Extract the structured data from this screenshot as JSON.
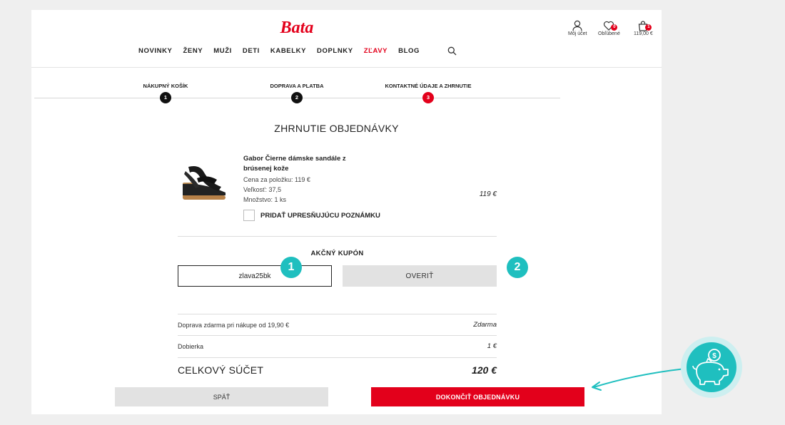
{
  "brand": {
    "logo_text": "Bata"
  },
  "account": {
    "my_account": "Môj účet",
    "favorites": "Obľúbené",
    "favorites_count": "0",
    "cart_total": "119,00 €",
    "cart_count": "1"
  },
  "nav": {
    "items": [
      {
        "label": "NOVINKY"
      },
      {
        "label": "ŽENY"
      },
      {
        "label": "MUŽI"
      },
      {
        "label": "DETI"
      },
      {
        "label": "KABELKY"
      },
      {
        "label": "DOPLNKY"
      },
      {
        "label": "ZĽAVY",
        "highlight": true
      },
      {
        "label": "BLOG"
      }
    ],
    "search_icon": "search-icon"
  },
  "steps": [
    {
      "label": "NÁKUPNÝ KOŠÍK",
      "number": "1"
    },
    {
      "label": "DOPRAVA A PLATBA",
      "number": "2"
    },
    {
      "label": "KONTAKTNÉ ÚDAJE A ZHRNUTIE",
      "number": "3",
      "active": true
    }
  ],
  "summary": {
    "title": "ZHRNUTIE OBJEDNÁVKY"
  },
  "product": {
    "name_line1": "Gabor Čierne dámske sandále z",
    "name_line2": "brúsenej kože",
    "unit_price": "Cena za položku: 119 €",
    "size": "Veľkosť: 37,5",
    "quantity": "Množstvo: 1 ks",
    "price": "119 €",
    "note_label": "PRIDAŤ UPRESŇUJÚCU POZNÁMKU"
  },
  "coupon": {
    "title": "AKČNÝ KUPÓN",
    "value": "zlava25bk",
    "verify_label": "OVERIŤ",
    "callout_1": "1",
    "callout_2": "2"
  },
  "rows": [
    {
      "label": "Doprava zdarma pri nákupe od 19,90 €",
      "value": "Zdarma"
    },
    {
      "label": "Dobierka",
      "value": "1 €"
    }
  ],
  "total": {
    "label": "CELKOVÝ SÚČET",
    "value": "120 €"
  },
  "actions": {
    "back_label": "SPÄŤ",
    "finish_label": "DOKONČIŤ OBJEDNÁVKU"
  },
  "colors": {
    "brand_red": "#e3001b",
    "accent_teal": "#1fbfbf",
    "dark": "#111111"
  }
}
